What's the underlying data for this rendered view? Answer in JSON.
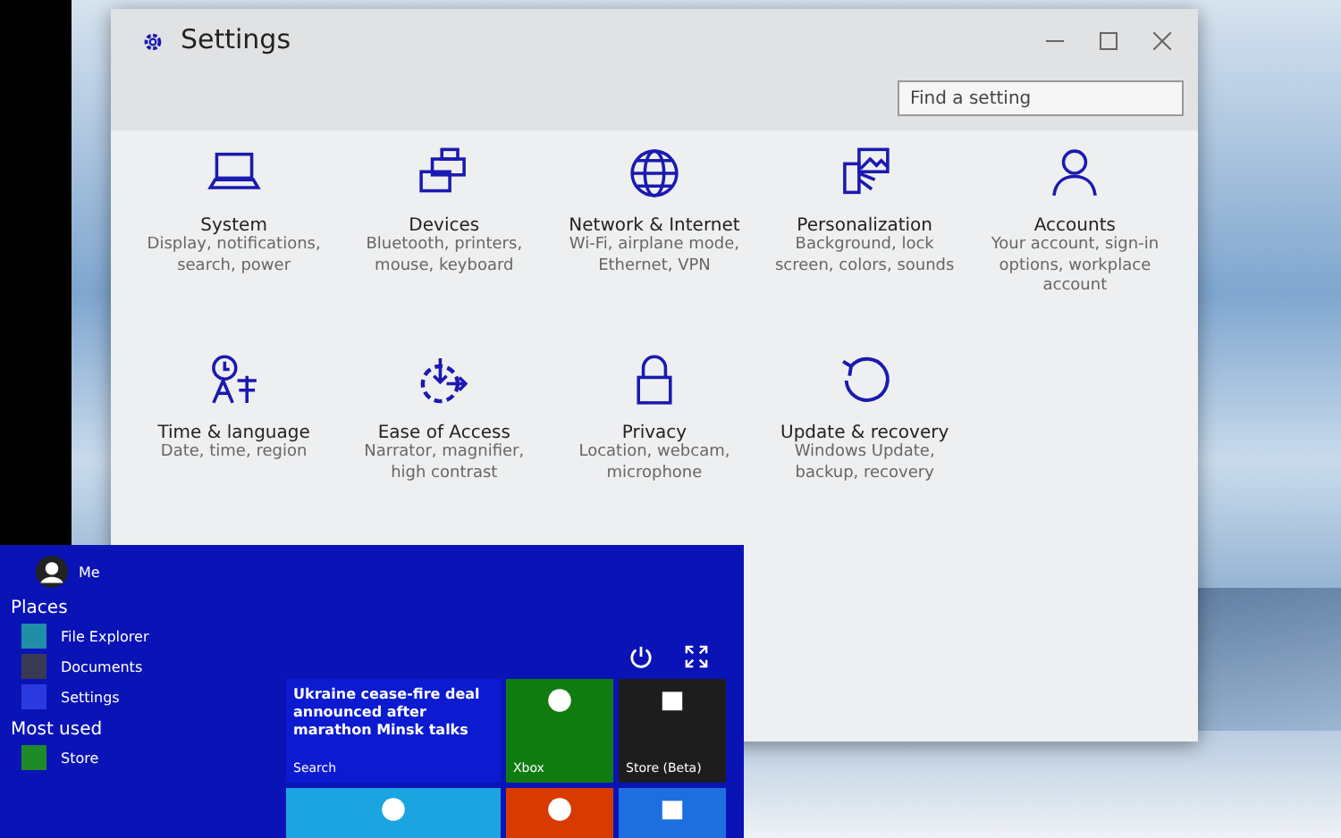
{
  "settings_window": {
    "title": "Settings",
    "search": {
      "placeholder": "Find a setting"
    },
    "categories": [
      {
        "name": "System",
        "description": "Display, notifications, search, power"
      },
      {
        "name": "Devices",
        "description": "Bluetooth, printers, mouse, keyboard"
      },
      {
        "name": "Network & Internet",
        "description": "Wi-Fi, airplane mode, Ethernet, VPN"
      },
      {
        "name": "Personalization",
        "description": "Background, lock screen, colors, sounds"
      },
      {
        "name": "Accounts",
        "description": "Your account, sign-in options, workplace account"
      },
      {
        "name": "Time & language",
        "description": "Date, time, region"
      },
      {
        "name": "Ease of Access",
        "description": "Narrator, magnifier, high contrast"
      },
      {
        "name": "Privacy",
        "description": "Location, webcam, microphone"
      },
      {
        "name": "Update & recovery",
        "description": "Windows Update, backup, recovery"
      }
    ]
  },
  "start_menu": {
    "user": "Me",
    "places_heading": "Places",
    "places": [
      {
        "label": "File Explorer",
        "color": "#1f8fa8"
      },
      {
        "label": "Documents",
        "color": "#3a3a55"
      },
      {
        "label": "Settings",
        "color": "#2a3ae0"
      }
    ],
    "most_used_heading": "Most used",
    "most_used": [
      {
        "label": "Store",
        "color": "#1e8a2a"
      }
    ],
    "tiles": [
      {
        "kind": "news",
        "headline": "Ukraine cease-fire deal announced after marathon Minsk talks",
        "label": "Search",
        "color": "#0c1ad0"
      },
      {
        "kind": "app",
        "label": "Xbox",
        "color": "#107c10"
      },
      {
        "kind": "app",
        "label": "Store (Beta)",
        "color": "#1d1d1d"
      },
      {
        "kind": "app",
        "color": "#1aa5e0"
      },
      {
        "kind": "app",
        "color": "#d83b01"
      },
      {
        "kind": "app",
        "color": "#1d6fe0"
      }
    ]
  }
}
